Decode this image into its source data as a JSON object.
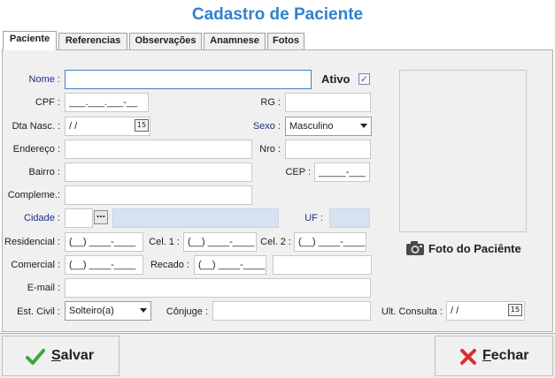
{
  "title": "Cadastro de Paciente",
  "tabs": [
    "Paciente",
    "Referencias",
    "Observações",
    "Anamnese",
    "Fotos"
  ],
  "form": {
    "nome_label": "Nome :",
    "nome_value": "",
    "ativo_label": "Ativo",
    "ativo_checked": true,
    "cpf_label": "CPF :",
    "cpf_mask": "___.___.___-__",
    "rg_label": "RG :",
    "dta_nasc_label": "Dta Nasc. :",
    "dta_nasc_value": " / /",
    "sexo_label": "Sexo :",
    "sexo_value": "Masculino",
    "endereco_label": "Endereço :",
    "nro_label": "Nro :",
    "bairro_label": "Bairro :",
    "cep_label": "CEP :",
    "cep_mask": "_____-___",
    "complemento_label": "Compleme.:",
    "cidade_label": "Cidade :",
    "uf_label": "UF :",
    "residencial_label": "Residencial :",
    "phone_mask": "(__) ____-____",
    "cel1_label": "Cel. 1 :",
    "cel2_label": "Cel. 2 :",
    "comercial_label": "Comercial :",
    "recado_label": "Recado :",
    "email_label": "E-mail :",
    "est_civil_label": "Est. Civil :",
    "est_civil_value": "Solteiro(a)",
    "conjuge_label": "Cônjuge :",
    "ult_consulta_label": "Ult. Consulta :",
    "ult_consulta_value": " / /",
    "foto_label": "Foto do Paciênte"
  },
  "buttons": {
    "salvar_first": "S",
    "salvar_rest": "alvar",
    "fechar_first": "F",
    "fechar_rest": "echar"
  },
  "icons": {
    "calendar": "calendar-icon",
    "camera": "camera-icon",
    "check": "check-icon",
    "close": "close-icon"
  },
  "colors": {
    "title": "#2f80d0",
    "required_label": "#1a2f8c",
    "readonly_field": "#d6e2f2"
  }
}
